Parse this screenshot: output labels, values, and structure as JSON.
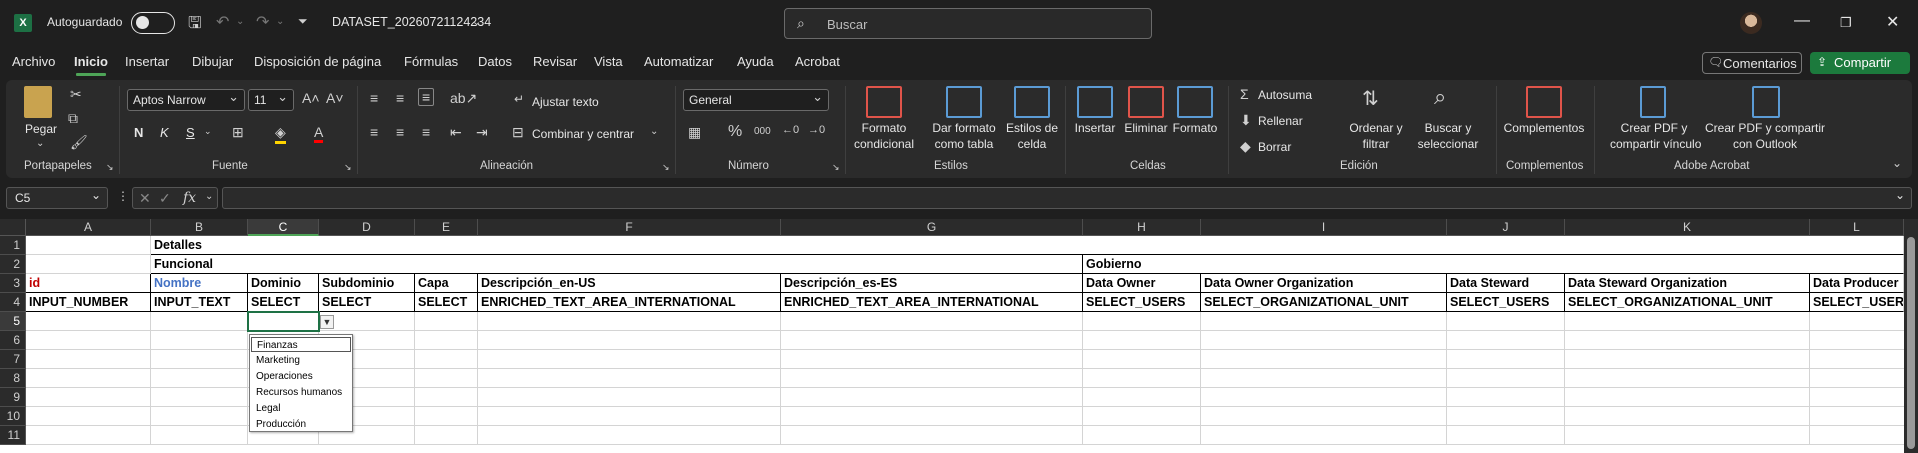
{
  "titlebar": {
    "autosave_label": "Autoguardado",
    "document_title": "DATASET_20260721124234",
    "search_placeholder": "Buscar"
  },
  "menu": {
    "items": [
      "Archivo",
      "Inicio",
      "Insertar",
      "Dibujar",
      "Disposición de página",
      "Fórmulas",
      "Datos",
      "Revisar",
      "Vista",
      "Automatizar",
      "Ayuda",
      "Acrobat"
    ],
    "active": "Inicio",
    "comments_label": "Comentarios",
    "share_label": "Compartir"
  },
  "ribbon": {
    "clipboard": {
      "paste": "Pegar",
      "group": "Portapapeles"
    },
    "font": {
      "name": "Aptos Narrow",
      "size": "11",
      "bold": "N",
      "italic": "K",
      "underline": "S",
      "group": "Fuente"
    },
    "alignment": {
      "wrap": "Ajustar texto",
      "merge": "Combinar y centrar",
      "group": "Alineación"
    },
    "number": {
      "format": "General",
      "group": "Número"
    },
    "styles": {
      "conditional": "Formato\ncondicional",
      "table": "Dar formato\ncomo tabla",
      "cell": "Estilos de\ncelda",
      "group": "Estilos"
    },
    "cells": {
      "insert": "Insertar",
      "delete": "Eliminar",
      "format": "Formato",
      "group": "Celdas"
    },
    "editing": {
      "autosum": "Autosuma",
      "fill": "Rellenar",
      "clear": "Borrar",
      "sort": "Ordenar y\nfiltrar",
      "find": "Buscar y\nseleccionar",
      "group": "Edición"
    },
    "addins": {
      "label": "Complementos",
      "group": "Complementos"
    },
    "acrobat": {
      "pdf_link": "Crear PDF y\ncompartir vínculo",
      "pdf_outlook": "Crear PDF y compartir\ncon Outlook",
      "group": "Adobe Acrobat"
    }
  },
  "formula_bar": {
    "name_box": "C5",
    "fx": "fx",
    "formula": ""
  },
  "sheet": {
    "columns": [
      "A",
      "B",
      "C",
      "D",
      "E",
      "F",
      "G",
      "H",
      "I",
      "J",
      "K",
      "L"
    ],
    "rows": [
      "1",
      "2",
      "3",
      "4",
      "5",
      "6",
      "7",
      "8",
      "9",
      "10",
      "11"
    ],
    "selected_column": "C",
    "selected_row": "5",
    "r1": {
      "B": "Detalles"
    },
    "r2": {
      "B": "Funcional",
      "H": "Gobierno"
    },
    "r3": {
      "A": "id",
      "B": "Nombre",
      "C": "Dominio",
      "D": "Subdominio",
      "E": "Capa",
      "F": "Descripción_en-US",
      "G": "Descripción_es-ES",
      "H": "Data Owner",
      "I": "Data Owner Organization",
      "J": "Data Steward",
      "K": "Data Steward Organization",
      "L": "Data Producer"
    },
    "r4": {
      "A": "INPUT_NUMBER",
      "B": "INPUT_TEXT",
      "C": "SELECT",
      "D": "SELECT",
      "E": "SELECT",
      "F": "ENRICHED_TEXT_AREA_INTERNATIONAL",
      "G": "ENRICHED_TEXT_AREA_INTERNATIONAL",
      "H": "SELECT_USERS",
      "I": "SELECT_ORGANIZATIONAL_UNIT",
      "J": "SELECT_USERS",
      "K": "SELECT_ORGANIZATIONAL_UNIT",
      "L": "SELECT_USERS"
    }
  },
  "dropdown": {
    "options": [
      "Finanzas",
      "Marketing",
      "Operaciones",
      "Recursos humanos",
      "Legal",
      "Producción"
    ],
    "highlighted": "Finanzas"
  }
}
